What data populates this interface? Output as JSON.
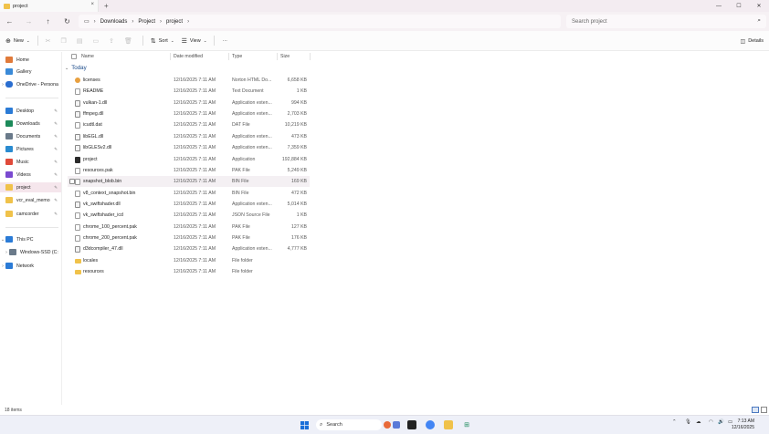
{
  "window": {
    "tab_title": "project",
    "tab_close": "×",
    "new_tab": "+",
    "minimize": "—",
    "maximize": "☐",
    "close": "✕"
  },
  "address": {
    "breadcrumbs": [
      "Downloads",
      "Project",
      "project"
    ],
    "separator": "›",
    "search_placeholder": "Search project"
  },
  "toolbar": {
    "new_label": "New",
    "sort_label": "Sort",
    "view_label": "View",
    "more_label": "···",
    "details_label": "Details"
  },
  "sidebar": {
    "items": [
      {
        "label": "Home",
        "icon": "home-icon",
        "color": "#e07a3a"
      },
      {
        "label": "Gallery",
        "icon": "gallery-icon",
        "color": "#3a8ad8"
      },
      {
        "label": "OneDrive - Persona",
        "icon": "cloud-icon",
        "color": "#2a6ed0"
      },
      {
        "label": "Desktop",
        "icon": "desktop-icon",
        "color": "#2b7bd6"
      },
      {
        "label": "Downloads",
        "icon": "downloads-icon",
        "color": "#1c8a5a"
      },
      {
        "label": "Documents",
        "icon": "documents-icon",
        "color": "#6a7a8a"
      },
      {
        "label": "Pictures",
        "icon": "pictures-icon",
        "color": "#2a8bd0"
      },
      {
        "label": "Music",
        "icon": "music-icon",
        "color": "#e04a3a"
      },
      {
        "label": "Videos",
        "icon": "videos-icon",
        "color": "#7a4ad0"
      },
      {
        "label": "project",
        "icon": "folder-icon",
        "color": "#f0c24a"
      },
      {
        "label": "vcr_eval_memo",
        "icon": "folder-icon",
        "color": "#f0c24a"
      },
      {
        "label": "camcorder",
        "icon": "folder-icon",
        "color": "#f0c24a"
      },
      {
        "label": "This PC",
        "icon": "computer-icon",
        "color": "#2b7bd6"
      },
      {
        "label": "Windows-SSD (C:",
        "icon": "drive-icon",
        "color": "#6a7a8a"
      },
      {
        "label": "Network",
        "icon": "network-icon",
        "color": "#2b7bd6"
      }
    ]
  },
  "list": {
    "columns": {
      "name": "Name",
      "date": "Date modified",
      "type": "Type",
      "size": "Size"
    },
    "group": "Today",
    "rows": [
      {
        "name": "licenses",
        "date": "12/16/2025 7:11 AM",
        "type": "Norton HTML Do...",
        "size": "6,658 KB",
        "icon": "browser"
      },
      {
        "name": "README",
        "date": "12/16/2025 7:11 AM",
        "type": "Text Document",
        "size": "1 KB",
        "icon": "doc"
      },
      {
        "name": "vulkan-1.dll",
        "date": "12/16/2025 7:11 AM",
        "type": "Application exten...",
        "size": "994 KB",
        "icon": "gear"
      },
      {
        "name": "ffmpeg.dll",
        "date": "12/16/2025 7:11 AM",
        "type": "Application exten...",
        "size": "2,703 KB",
        "icon": "gear"
      },
      {
        "name": "icudtl.dat",
        "date": "12/16/2025 7:11 AM",
        "type": "DAT File",
        "size": "10,219 KB",
        "icon": "doc"
      },
      {
        "name": "libEGL.dll",
        "date": "12/16/2025 7:11 AM",
        "type": "Application exten...",
        "size": "473 KB",
        "icon": "gear"
      },
      {
        "name": "libGLESv2.dll",
        "date": "12/16/2025 7:11 AM",
        "type": "Application exten...",
        "size": "7,359 KB",
        "icon": "gear"
      },
      {
        "name": "project",
        "date": "12/16/2025 7:11 AM",
        "type": "Application",
        "size": "192,884 KB",
        "icon": "app"
      },
      {
        "name": "resources.pak",
        "date": "12/16/2025 7:11 AM",
        "type": "PAK File",
        "size": "5,249 KB",
        "icon": "doc"
      },
      {
        "name": "snapshot_blob.bin",
        "date": "12/16/2025 7:11 AM",
        "type": "BIN File",
        "size": "169 KB",
        "icon": "doc"
      },
      {
        "name": "v8_context_snapshot.bin",
        "date": "12/16/2025 7:11 AM",
        "type": "BIN File",
        "size": "472 KB",
        "icon": "doc"
      },
      {
        "name": "vk_swiftshader.dll",
        "date": "12/16/2025 7:11 AM",
        "type": "Application exten...",
        "size": "5,014 KB",
        "icon": "gear"
      },
      {
        "name": "vk_swiftshader_icd",
        "date": "12/16/2025 7:11 AM",
        "type": "JSON Source File",
        "size": "1 KB",
        "icon": "doc"
      },
      {
        "name": "chrome_100_percent.pak",
        "date": "12/16/2025 7:11 AM",
        "type": "PAK File",
        "size": "127 KB",
        "icon": "doc"
      },
      {
        "name": "chrome_200_percent.pak",
        "date": "12/16/2025 7:11 AM",
        "type": "PAK File",
        "size": "176 KB",
        "icon": "doc"
      },
      {
        "name": "d3dcompiler_47.dll",
        "date": "12/16/2025 7:11 AM",
        "type": "Application exten...",
        "size": "4,777 KB",
        "icon": "gear"
      },
      {
        "name": "locales",
        "date": "12/16/2025 7:11 AM",
        "type": "File folder",
        "size": "",
        "icon": "folder"
      },
      {
        "name": "resources",
        "date": "12/16/2025 7:11 AM",
        "type": "File folder",
        "size": "",
        "icon": "folder"
      }
    ]
  },
  "status": {
    "count": "18 items"
  },
  "taskbar": {
    "search_label": "Search",
    "time": "7:13 AM",
    "date": "12/16/2025"
  }
}
